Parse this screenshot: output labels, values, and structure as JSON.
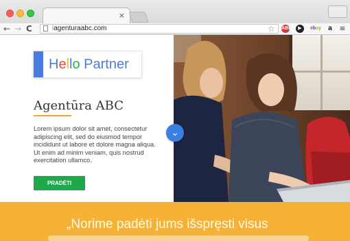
{
  "browser": {
    "tab_close": "×",
    "nav_back": "←",
    "nav_forward": "→",
    "reload": "C",
    "url_prefix": "i",
    "url": "agenturaabc.com",
    "star": "☆",
    "extensions": {
      "adblock": "ABP",
      "play": "▶",
      "ebay": "ebay",
      "amazon": "a",
      "menu": "≡"
    }
  },
  "hero": {
    "logo": {
      "letters": [
        "H",
        "e",
        "l",
        "l",
        "o",
        " Partner"
      ]
    },
    "headline": "Agentūra ABC",
    "body": "Lorem ipsum dolor sit amet, consectetur adipiscing elit, sed do eiusmod tempor incididunt ut labore et dolore magna aliqua. Ut enim ad minim veniam, quis nostrud exercitation ullamco.",
    "cta_label": "PRADĖTI",
    "scroll_icon": "⌄"
  },
  "banner": {
    "quote_line_1": "„Norime padėti jums išspręsti visus"
  },
  "colors": {
    "accent_blue": "#4a7be0",
    "cta_green": "#1fa84a",
    "banner_yellow": "#f6b236",
    "headline_underline": "#f5a623"
  }
}
